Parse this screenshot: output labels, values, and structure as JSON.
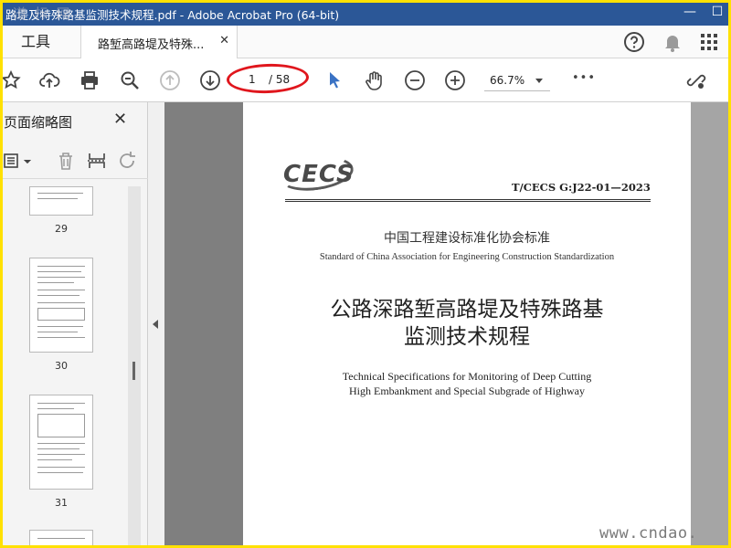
{
  "window": {
    "title": "路堤及特殊路基监测技术规程.pdf - Adobe Acrobat Pro (64-bit)",
    "watermark_top": "道 标 网",
    "minimize": "—",
    "maximize": "☐"
  },
  "tabs": {
    "tools_label": "工具",
    "doc_tab_label": "路堑高路堤及特殊...",
    "doc_tab_close": "✕"
  },
  "toolbar": {
    "page_current": "1",
    "page_total": "/ 58",
    "zoom": "66.7%",
    "more": "•••",
    "colors": {
      "accent": "#2b5797",
      "highlight": "#e0161d",
      "select_arrow": "#3a72c4"
    }
  },
  "left_panel": {
    "title": "页面缩略图",
    "close": "✕",
    "thumbnails": [
      {
        "label": "29"
      },
      {
        "label": "30"
      },
      {
        "label": "31"
      }
    ]
  },
  "document": {
    "logo": "CECS",
    "standard_number": "T/CECS G:J22-01—2023",
    "association_cn": "中国工程建设标准化协会标准",
    "association_en": "Standard of China Association for Engineering Construction Standardization",
    "title_cn_line1": "公路深路堑高路堤及特殊路基",
    "title_cn_line2": "监测技术规程",
    "title_en_line1": "Technical Specifications for Monitoring of Deep Cutting",
    "title_en_line2": "High Embankment and Special Subgrade of Highway",
    "watermark_bottom": "www.cndao."
  }
}
